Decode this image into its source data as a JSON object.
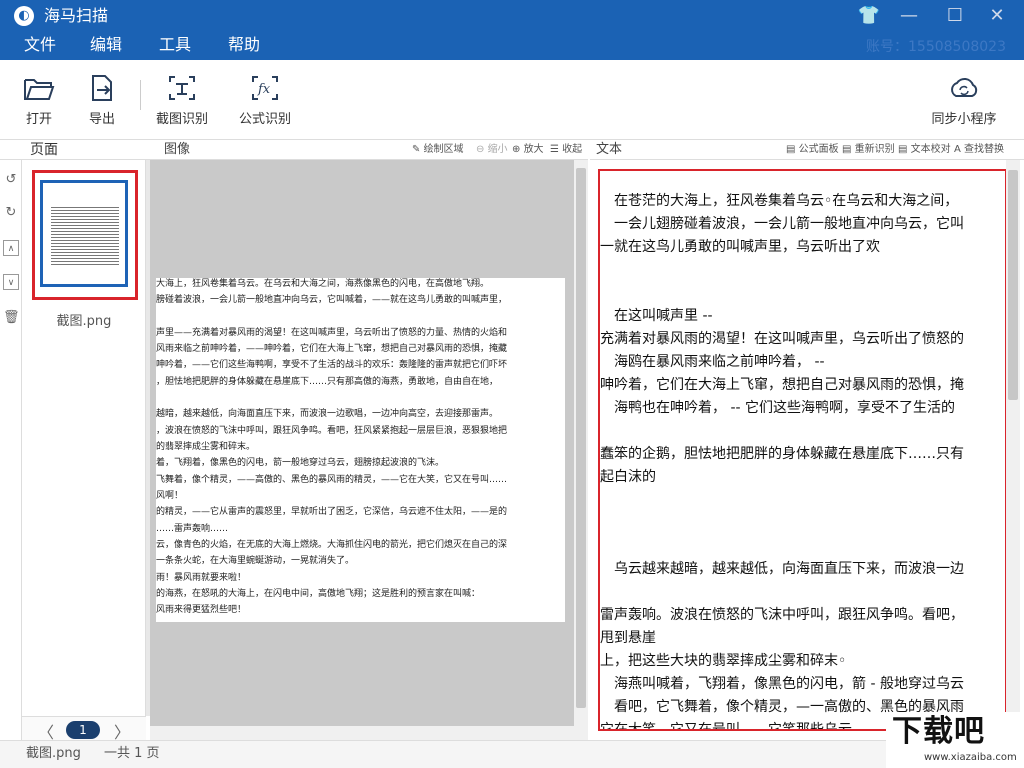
{
  "app": {
    "title": "海马扫描",
    "logo_glyph": "⬤",
    "account": "账号：15508508023",
    "colors": {
      "title_bar": "#1b62b4",
      "highlight": "#d9242b"
    }
  },
  "window_controls": {
    "skin": "👕",
    "minimize": "—",
    "maximize": "☐",
    "close": "✕"
  },
  "menu": [
    "文件",
    "编辑",
    "工具",
    "帮助"
  ],
  "toolbar": {
    "open": "打开",
    "export": "导出",
    "screenshot_ocr": "截图识别",
    "formula_ocr": "公式识别",
    "sync": "同步小程序"
  },
  "pages_panel": {
    "header": "页面",
    "thumbnail_name": "截图.png",
    "current_page": "1",
    "prev": "〈",
    "next": "〉"
  },
  "image_panel": {
    "header": "图像",
    "draw_area": "绘制区域",
    "zoom_out": "缩小",
    "zoom_in": "放大",
    "collapse": "收起",
    "scan_lines": [
      "大海上，狂风卷集着乌云。在乌云和大海之间，海燕像黑色的闪电，在高傲地飞翔。",
      "膀碰着波浪，一会儿箭一般地直冲向乌云，它叫喊着，——就在这鸟儿勇敢的叫喊声里，",
      "",
      "声里——充满着对暴风雨的渴望！在这叫喊声里，乌云听出了愤怒的力量、热情的火焰和",
      "风雨来临之前呻吟着，——呻吟着，它们在大海上飞窜，想把自己对暴风雨的恐惧，掩藏",
      "呻吟着，——它们这些海鸭啊，享受不了生活的战斗的欢乐：轰隆隆的雷声就把它们吓坏",
      "，胆怯地把肥胖的身体躲藏在悬崖底下……只有那高傲的海燕，勇敢地，自由自在地，",
      "",
      "越暗，越来越低，向海面直压下来，而波浪一边歌唱，一边冲向高空，去迎接那雷声。",
      "，波浪在愤怒的飞沫中呼叫，跟狂风争鸣。看吧，狂风紧紧抱起一层层巨浪，恶狠狠地把",
      "的翡翠摔成尘雾和碎末。",
      "着，飞翔着，像黑色的闪电，箭一般地穿过乌云，翅膀掠起波浪的飞沫。",
      "飞舞着，像个精灵，——高傲的、黑色的暴风雨的精灵，——它在大笑，它又在号叫……",
      "风啊！",
      "的精灵，——它从雷声的震怒里，早就听出了困乏，它深信，乌云遮不住太阳，——是的",
      "……雷声轰响……",
      "云，像青色的火焰，在无底的大海上燃烧。大海抓住闪电的箭光，把它们熄灭在自己的深",
      "一条条火蛇，在大海里蜿蜒游动，一晃就消失了。",
      "雨！暴风雨就要来啦！",
      "的海燕，在怒吼的大海上，在闪电中间，高傲地飞翔；这是胜利的预言家在叫喊：",
      "风雨来得更猛烈些吧！"
    ]
  },
  "text_panel": {
    "header": "文本",
    "formula_panel": "公式面板",
    "reocr": "重新识别",
    "proofread": "文本校对",
    "find_replace": "查找替换",
    "lines": [
      "　在苍茫的大海上，狂风卷集着乌云◦在乌云和大海之间，",
      "　一会儿翅膀碰着波浪，一会儿箭一般地直冲向乌云，它叫",
      "一就在这鸟儿勇敢的叫喊声里，乌云听出了欢",
      "",
      "",
      "　在这叫喊声里 --",
      "充满着对暴风雨的渴望！在这叫喊声里，乌云听出了愤怒的",
      "　海鸥在暴风雨来临之前呻吟着，  --",
      "呻吟着，它们在大海上飞窜，想把自己对暴风雨的恐惧，掩",
      "　海鸭也在呻吟着，  -- 它们这些海鸭啊，享受不了生活的",
      "",
      "蠢笨的企鹅，胆怯地把肥胖的身体躲藏在悬崖底下……只有",
      "起白沫的",
      "",
      "",
      "",
      "　乌云越来越暗，越来越低，向海面直压下来，而波浪一边",
      "",
      "雷声轰响。波浪在愤怒的飞沫中呼叫，跟狂风争鸣。看吧，",
      "甩到悬崖",
      "上，把这些大块的翡翠摔成尘雾和碎末◦",
      "　海燕叫喊着，飞翔着，像黑色的闪电，箭 - 般地穿过乌云",
      "　看吧，它飞舞着，像个精灵，—一高傲的、黑色的暴风雨",
      "它在大笑，它又在号叫……它笑那些乌云，"
    ]
  },
  "status": {
    "file": "截图.png",
    "pages": "一共 1 页"
  },
  "watermark": {
    "text": "下载吧",
    "url": "www.xiazaiba.com"
  }
}
